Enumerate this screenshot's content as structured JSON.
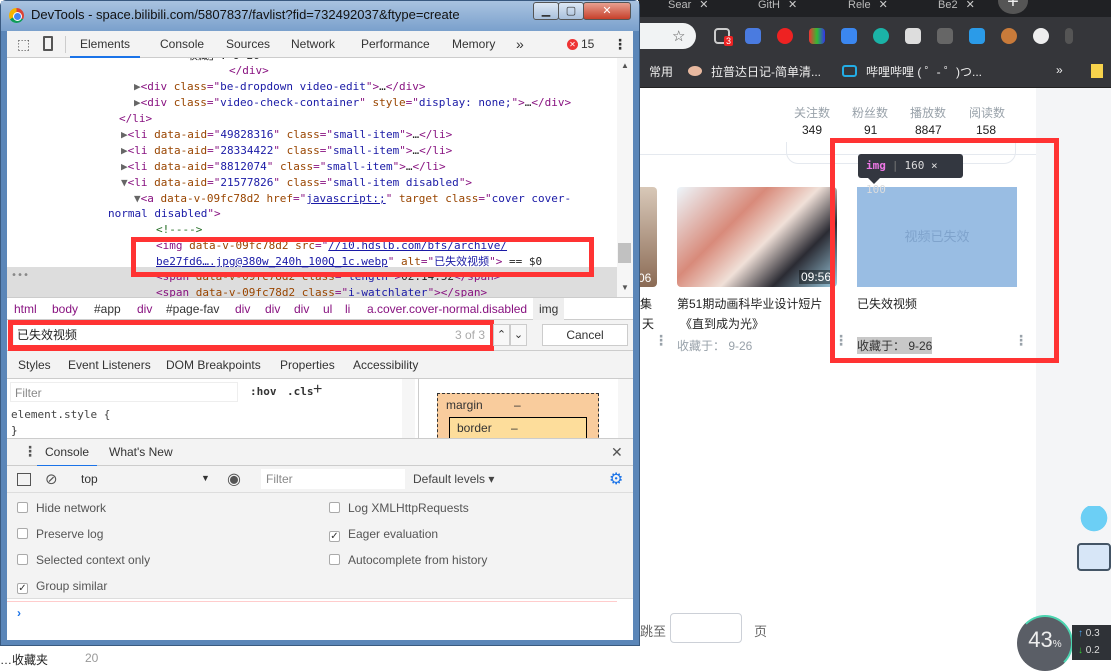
{
  "browser": {
    "tabs": [
      "Sear",
      "GitH",
      "Rele",
      "Be2"
    ],
    "extension_badge": "3",
    "bookmarks": [
      "常用",
      "拉普达日记-简单清...",
      "哔哩哔哩 ( ゜- ゜)つ..."
    ],
    "bookmarks_more": "»"
  },
  "page": {
    "stats": [
      {
        "label": "关注数",
        "value": "349"
      },
      {
        "label": "粉丝数",
        "value": "91"
      },
      {
        "label": "播放数",
        "value": "8847"
      },
      {
        "label": "阅读数",
        "value": "158"
      }
    ],
    "cards": [
      {
        "partial_title": "集",
        "partial_title2": "天",
        "duration": "06"
      },
      {
        "title": "第51期动画科毕业设计短片",
        "title2": "《直到成为光》",
        "duration": "09:56",
        "date": "收藏于： 9-26"
      },
      {
        "title": "已失效视频",
        "placeholder": "视频已失效",
        "date": "收藏于： 9-26",
        "color": "#99bde3"
      }
    ],
    "tooltip": {
      "tag": "img",
      "size": "160 × 100"
    },
    "jump_label": "跳至",
    "page_label": "页",
    "gauge": "43",
    "gauge_unit": "%",
    "net_up": "0.3",
    "net_down": "0.2",
    "left_partial": "…收藏夹",
    "left_count": "20"
  },
  "devtools": {
    "title": "DevTools - space.bilibili.com/5807837/favlist?fid=732492037&ftype=create",
    "tabs": [
      "Elements",
      "Console",
      "Sources",
      "Network",
      "Performance",
      "Memory"
    ],
    "more": "»",
    "error_count": "15",
    "tree": [
      [
        [
          "pl",
          "收藏」: 9-26"
        ]
      ],
      [
        [
          "tg",
          "</div>"
        ]
      ],
      [
        [
          "ar",
          "▶"
        ],
        [
          "tg",
          "<div "
        ],
        [
          "an",
          "class"
        ],
        [
          "tg",
          "=\""
        ],
        [
          "av",
          "be-dropdown video-edit"
        ],
        [
          "tg",
          "\">"
        ],
        [
          "pl",
          "…"
        ],
        [
          "tg",
          "</div>"
        ]
      ],
      [
        [
          "ar",
          "▶"
        ],
        [
          "tg",
          "<div "
        ],
        [
          "an",
          "class"
        ],
        [
          "tg",
          "=\""
        ],
        [
          "av",
          "video-check-container"
        ],
        [
          "tg",
          "\" "
        ],
        [
          "an",
          "style"
        ],
        [
          "tg",
          "=\""
        ],
        [
          "av",
          "display: none;"
        ],
        [
          "tg",
          "\">"
        ],
        [
          "pl",
          "…"
        ],
        [
          "tg",
          "</div>"
        ]
      ],
      [
        [
          "tg",
          "</li>"
        ]
      ],
      [
        [
          "ar",
          "▶"
        ],
        [
          "tg",
          "<li "
        ],
        [
          "an",
          "data-aid"
        ],
        [
          "tg",
          "=\""
        ],
        [
          "av",
          "49828316"
        ],
        [
          "tg",
          "\" "
        ],
        [
          "an",
          "class"
        ],
        [
          "tg",
          "=\""
        ],
        [
          "av",
          "small-item"
        ],
        [
          "tg",
          "\">"
        ],
        [
          "pl",
          "…"
        ],
        [
          "tg",
          "</li>"
        ]
      ],
      [
        [
          "ar",
          "▶"
        ],
        [
          "tg",
          "<li "
        ],
        [
          "an",
          "data-aid"
        ],
        [
          "tg",
          "=\""
        ],
        [
          "av",
          "28334422"
        ],
        [
          "tg",
          "\" "
        ],
        [
          "an",
          "class"
        ],
        [
          "tg",
          "=\""
        ],
        [
          "av",
          "small-item"
        ],
        [
          "tg",
          "\">"
        ],
        [
          "pl",
          "…"
        ],
        [
          "tg",
          "</li>"
        ]
      ],
      [
        [
          "ar",
          "▶"
        ],
        [
          "tg",
          "<li "
        ],
        [
          "an",
          "data-aid"
        ],
        [
          "tg",
          "=\""
        ],
        [
          "av",
          "8812074"
        ],
        [
          "tg",
          "\" "
        ],
        [
          "an",
          "class"
        ],
        [
          "tg",
          "=\""
        ],
        [
          "av",
          "small-item"
        ],
        [
          "tg",
          "\">"
        ],
        [
          "pl",
          "…"
        ],
        [
          "tg",
          "</li>"
        ]
      ],
      [
        [
          "ar",
          "▼"
        ],
        [
          "tg",
          "<li "
        ],
        [
          "an",
          "data-aid"
        ],
        [
          "tg",
          "=\""
        ],
        [
          "av",
          "21577826"
        ],
        [
          "tg",
          "\" "
        ],
        [
          "an",
          "class"
        ],
        [
          "tg",
          "=\""
        ],
        [
          "av",
          "small-item disabled"
        ],
        [
          "tg",
          "\">"
        ]
      ],
      [
        [
          "ar",
          "▼"
        ],
        [
          "tg",
          "<a "
        ],
        [
          "an",
          "data-v-09fc78d2 href"
        ],
        [
          "tg",
          "=\""
        ],
        [
          "lk",
          "javascript:;"
        ],
        [
          "tg",
          "\" "
        ],
        [
          "an",
          "target class"
        ],
        [
          "tg",
          "=\""
        ],
        [
          "av",
          "cover cover-"
        ]
      ],
      [
        [
          "av",
          "normal disabled"
        ],
        [
          "tg",
          "\">"
        ]
      ],
      [
        [
          "cm",
          "<!---->"
        ]
      ],
      [
        [
          "tg",
          "<img "
        ],
        [
          "an",
          "data-v-09fc78d2 src"
        ],
        [
          "tg",
          "=\""
        ],
        [
          "lk",
          "//i0.hdslb.com/bfs/archive/"
        ]
      ],
      [
        [
          "lk",
          "be27fd6….jpg@380w_240h_100Q_1c.webp"
        ],
        [
          "tg",
          "\" "
        ],
        [
          "an",
          "alt"
        ],
        [
          "tg",
          "=\""
        ],
        [
          "av",
          "已失效视频"
        ],
        [
          "tg",
          "\">"
        ],
        [
          "pl",
          " == $0"
        ]
      ],
      [
        [
          "tg",
          "<span "
        ],
        [
          "an",
          "data-v-09fc78d2 class"
        ],
        [
          "tg",
          "=\""
        ],
        [
          "av",
          "length"
        ],
        [
          "tg",
          "\">"
        ],
        [
          "pl",
          "02:14:52"
        ],
        [
          "tg",
          "</span>"
        ]
      ],
      [
        [
          "tg",
          "<span "
        ],
        [
          "an",
          "data-v-09fc78d2 class"
        ],
        [
          "tg",
          "=\""
        ],
        [
          "av",
          "i-watchlater"
        ],
        [
          "tg",
          "\"></span>"
        ]
      ]
    ],
    "breadcrumbs": [
      "html",
      "body",
      "#app",
      "div",
      "#page-fav",
      "div",
      "div",
      "div",
      "ul",
      "li",
      "a.cover.cover-normal.disabled",
      "img"
    ],
    "search": {
      "value": "已失效视频",
      "count": "3 of 3",
      "cancel": "Cancel"
    },
    "styles_tabs": [
      "Styles",
      "Event Listeners",
      "DOM Breakpoints",
      "Properties",
      "Accessibility"
    ],
    "styles": {
      "filter_placeholder": "Filter",
      "hov": ":hov",
      "cls": ".cls",
      "plus": "+",
      "rule": "element.style {",
      "rule_end": "}"
    },
    "boxmodel": {
      "margin": "margin",
      "border": "border",
      "dash": "–"
    },
    "drawer_tabs": [
      "Console",
      "What's New"
    ],
    "console": {
      "context": "top",
      "filter_placeholder": "Filter",
      "levels": "Default levels ▾"
    },
    "settings": [
      {
        "label": "Hide network",
        "checked": false
      },
      {
        "label": "Log XMLHttpRequests",
        "checked": false
      },
      {
        "label": "Preserve log",
        "checked": false
      },
      {
        "label": "Eager evaluation",
        "checked": true
      },
      {
        "label": "Selected context only",
        "checked": false
      },
      {
        "label": "Autocomplete from history",
        "checked": false
      },
      {
        "label": "Group similar",
        "checked": true
      }
    ],
    "prompt": "›"
  }
}
